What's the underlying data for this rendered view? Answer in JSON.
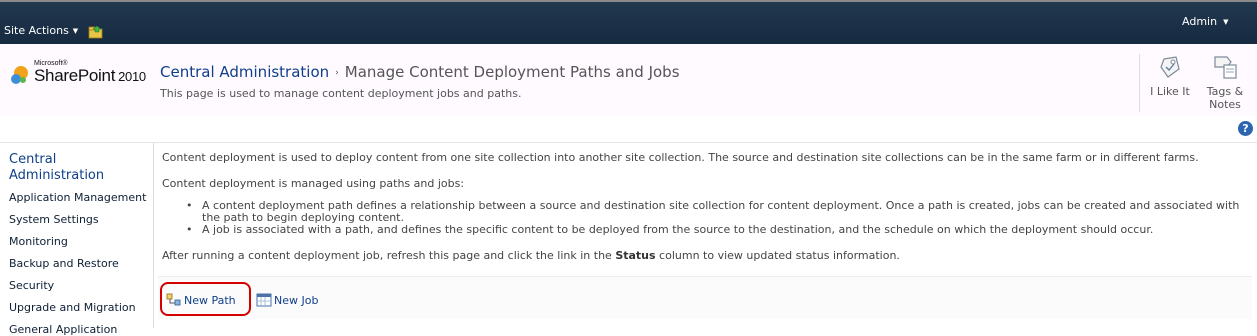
{
  "ribbon": {
    "site_actions_label": "Site Actions",
    "user_label": "Admin"
  },
  "title_area": {
    "logo": {
      "microsoft": "Microsoft®",
      "product": "SharePoint",
      "version": "2010"
    },
    "breadcrumb_root": "Central Administration",
    "breadcrumb_separator": "›",
    "page_title": "Manage Content Deployment Paths and Jobs",
    "page_description": "This page is used to manage content deployment jobs and paths.",
    "actions": {
      "like_label": "I Like It",
      "tags_label_1": "Tags &",
      "tags_label_2": "Notes"
    }
  },
  "help": {
    "label": "?"
  },
  "left_nav": {
    "heading_1": "Central",
    "heading_2": "Administration",
    "items": [
      {
        "label": "Application Management"
      },
      {
        "label": "System Settings"
      },
      {
        "label": "Monitoring"
      },
      {
        "label": "Backup and Restore"
      },
      {
        "label": "Security"
      },
      {
        "label": "Upgrade and Migration"
      },
      {
        "label": "General Application"
      }
    ]
  },
  "content": {
    "intro": "Content deployment is used to deploy content from one site collection into another site collection. The source and destination site collections can be in the same farm or in different farms.",
    "managed": "Content deployment is managed using paths and jobs:",
    "bullets": [
      "A content deployment path defines a relationship between a source and destination site collection for content deployment. Once a path is created, jobs can be created and associated with the path to begin deploying content.",
      "A job is associated with a path, and defines the specific content to be deployed from the source to the destination, and the schedule on which the deployment should occur."
    ],
    "after_pre": "After running a content deployment job, refresh this page and click the link in the ",
    "after_bold": "Status",
    "after_post": " column to view updated status information."
  },
  "toolbar": {
    "new_path_label": "New Path",
    "new_job_label": "New Job"
  },
  "colors": {
    "ribbon": "#1b3047",
    "link": "#0f3f8a",
    "highlight": "#d40000"
  }
}
